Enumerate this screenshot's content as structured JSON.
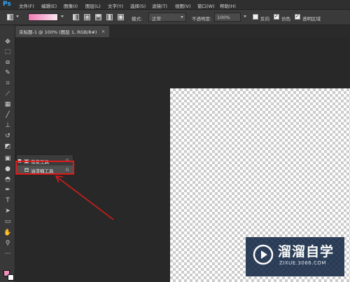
{
  "app": {
    "logo": "Ps"
  },
  "menubar": {
    "items": [
      {
        "label": "文件(F)"
      },
      {
        "label": "编辑(E)"
      },
      {
        "label": "图像(I)"
      },
      {
        "label": "图层(L)"
      },
      {
        "label": "文字(Y)"
      },
      {
        "label": "选择(S)"
      },
      {
        "label": "滤镜(T)"
      },
      {
        "label": "视图(V)"
      },
      {
        "label": "窗口(W)"
      },
      {
        "label": "帮助(H)"
      }
    ]
  },
  "options": {
    "mode_label": "模式:",
    "mode_value": "正常",
    "opacity_label": "不透明度:",
    "opacity_value": "100%",
    "reverse_label": "反向",
    "reverse_checked": false,
    "dither_label": "仿色",
    "dither_checked": true,
    "transparency_label": "透明区域",
    "transparency_checked": true,
    "gradient_colors": [
      "#f07ab4",
      "#fbe6f1"
    ]
  },
  "document": {
    "tab_label": "未标题-1 @ 100% (图层 1, RGB/8#)",
    "close_glyph": "×"
  },
  "flyout": {
    "items": [
      {
        "label": "渐变工具",
        "shortcut": "G",
        "icon": "gradient-icon",
        "active": true
      },
      {
        "label": "油漆桶工具",
        "shortcut": "G",
        "icon": "paint-bucket-icon",
        "active": false
      }
    ]
  },
  "colors": {
    "highlight": "#e01b1b",
    "foreground": "#f090b8",
    "background": "#ffffff",
    "accent": "#31a8ff"
  },
  "watermark": {
    "title": "溜溜自学",
    "url": "ZIXUE.3066.COM"
  }
}
